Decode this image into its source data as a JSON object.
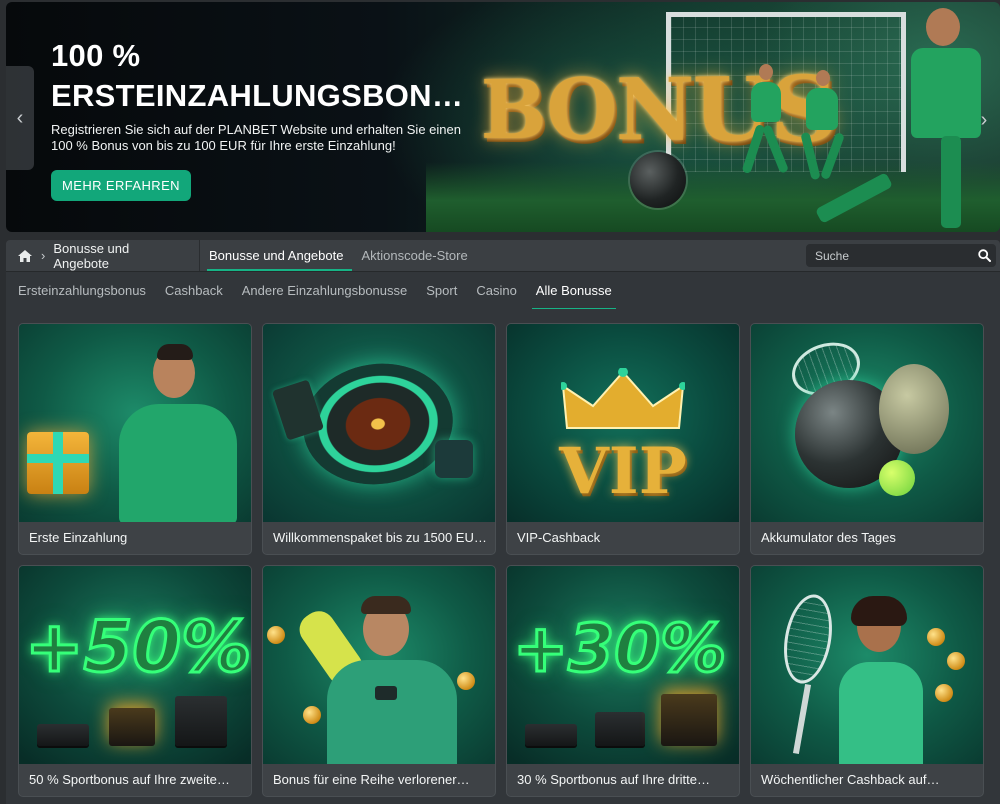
{
  "hero": {
    "title_line1": "100 %",
    "title_line2": "ERSTEINZAHLUNGSBONU…",
    "description": "Registrieren Sie sich auf der PLANBET Website und erhalten Sie einen 100 % Bonus von bis zu 100 EUR für Ihre erste Einzahlung!",
    "cta_label": "MEHR ERFAHREN",
    "art_word": "BONUS",
    "prev_glyph": "‹",
    "next_glyph": "›"
  },
  "breadcrumb": {
    "separator": "›",
    "current": "Bonusse und Angebote"
  },
  "topnav": {
    "tabs": [
      {
        "label": "Bonusse und Angebote",
        "active": true
      },
      {
        "label": "Aktionscode-Store",
        "active": false
      }
    ]
  },
  "search": {
    "placeholder": "Suche"
  },
  "subnav": {
    "items": [
      {
        "label": "Ersteinzahlungsbonus",
        "active": false
      },
      {
        "label": "Cashback",
        "active": false
      },
      {
        "label": "Andere Einzahlungsbonusse",
        "active": false
      },
      {
        "label": "Sport",
        "active": false
      },
      {
        "label": "Casino",
        "active": false
      },
      {
        "label": "Alle Bonusse",
        "active": true
      }
    ]
  },
  "cards": [
    {
      "title": "Erste Einzahlung"
    },
    {
      "title": "Willkommenspaket bis zu 1500 EU…"
    },
    {
      "title": "VIP-Cashback",
      "art_text": "VIP"
    },
    {
      "title": "Akkumulator des Tages"
    },
    {
      "title": "50 % Sportbonus auf Ihre zweite…",
      "art_text": "+50%"
    },
    {
      "title": "Bonus für eine Reihe verlorener…"
    },
    {
      "title": "30 % Sportbonus auf Ihre dritte…",
      "art_text": "+30%"
    },
    {
      "title": "Wöchentlicher Cashback auf…"
    }
  ],
  "colors": {
    "accent": "#12a77a",
    "background": "#2b2e31",
    "navbar": "#3b3f43",
    "card": "#3e4246"
  }
}
